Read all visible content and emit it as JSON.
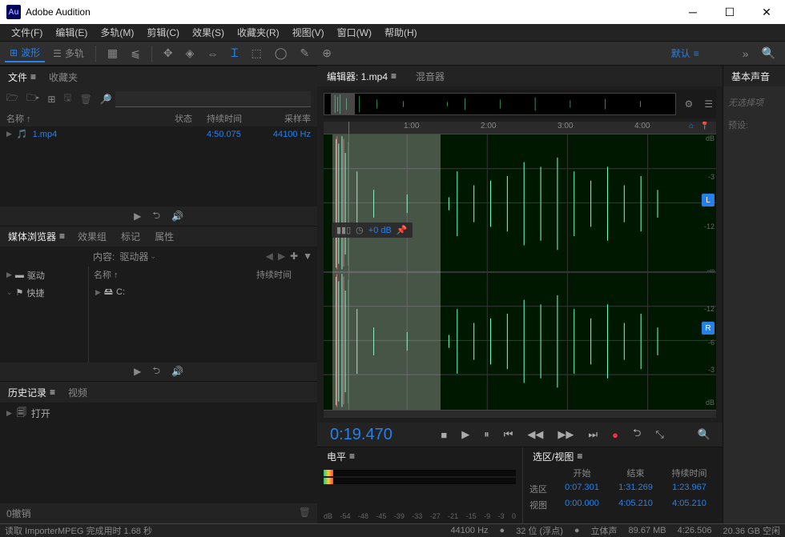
{
  "title": "Adobe Audition",
  "logo_text": "Au",
  "menu": [
    "文件(F)",
    "编辑(E)",
    "多轨(M)",
    "剪辑(C)",
    "效果(S)",
    "收藏夹(R)",
    "视图(V)",
    "窗口(W)",
    "帮助(H)"
  ],
  "toolbar": {
    "waveform": "波形",
    "multitrack": "多轨",
    "workspace": "默认"
  },
  "files_panel": {
    "tab_files": "文件",
    "tab_fav": "收藏夹",
    "search_ph": "",
    "col_name": "名称 ↑",
    "col_state": "状态",
    "col_dur": "持续时间",
    "col_sr": "采样率",
    "items": [
      {
        "name": "1.mp4",
        "dur": "4:50.075",
        "sr": "44100 Hz"
      }
    ]
  },
  "media_browser": {
    "tab_mb": "媒体浏览器",
    "tab_fx": "效果组",
    "tab_mark": "标记",
    "tab_prop": "属性",
    "content_label": "内容:",
    "content_value": "驱动器",
    "tree": [
      "驱动",
      "快捷"
    ],
    "col_name": "名称 ↑",
    "col_dur": "持续时间",
    "item_c": "C:"
  },
  "history": {
    "tab_hist": "历史记录",
    "tab_video": "视频",
    "items": [
      "打开"
    ],
    "undo": "0撤销"
  },
  "editor": {
    "tab_editor": "编辑器: 1.mp4",
    "tab_mixer": "混音器",
    "ruler_marks": [
      "1:00",
      "2:00",
      "3:00",
      "4:00"
    ],
    "db_marks": [
      "dB",
      "-3",
      "-6",
      "-12",
      "-∞",
      "-12",
      "-6",
      "-3",
      "dB"
    ],
    "hud_db": "+0 dB",
    "ch_l": "L",
    "ch_r": "R",
    "timecode": "0:19.470"
  },
  "essential": {
    "title": "基本声音",
    "nosel": "无选择项",
    "preset": "预设:"
  },
  "levels": {
    "title": "电平",
    "marks": [
      "dB",
      "-54",
      "-48",
      "-45",
      "-39",
      "-33",
      "-27",
      "-21",
      "-15",
      "-9",
      "-3",
      "0"
    ]
  },
  "selinfo": {
    "title": "选区/视图",
    "h_start": "开始",
    "h_end": "结束",
    "h_dur": "持续时间",
    "sel_label": "选区",
    "sel": [
      "0:07.301",
      "1:31.269",
      "1:23.967"
    ],
    "view_label": "视图",
    "view": [
      "0:00.000",
      "4:05.210",
      "4:05.210"
    ]
  },
  "status": {
    "msg": "读取 ImporterMPEG 完成用时 1.68 秒",
    "sr": "44100 Hz",
    "bits": "32 位 (浮点)",
    "ch": "立体声",
    "size": "89.67 MB",
    "total": "4:26.506",
    "disk": "20.36 GB 空闲"
  }
}
